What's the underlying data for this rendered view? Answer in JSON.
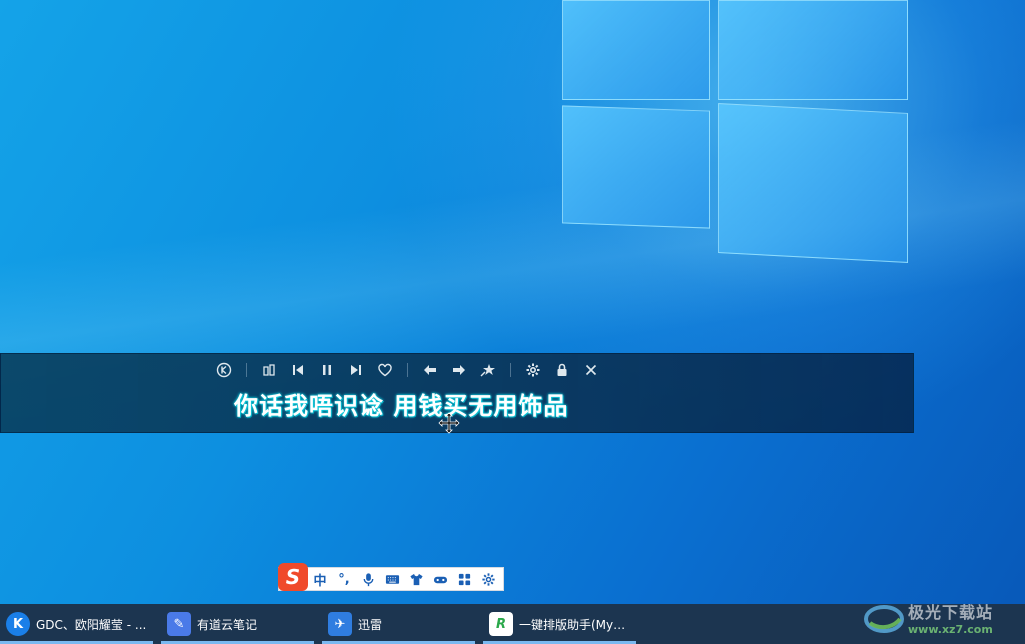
{
  "lyrics": {
    "current_line": "你话我唔识谂  用钱买无用饰品"
  },
  "ime": {
    "logo": "S",
    "items": [
      {
        "name": "chinese-mode",
        "label": "中"
      },
      {
        "name": "punctuation",
        "label": "°,"
      }
    ]
  },
  "taskbar": {
    "items": [
      {
        "label": "GDC、欧阳耀莹 - ...",
        "icon": "kugou-icon",
        "icon_text": "K",
        "color": "#1a7fe8"
      },
      {
        "label": "有道云笔记",
        "icon": "youdao-note-icon",
        "icon_text": "✎",
        "color": "#4a7ae8"
      },
      {
        "label": "迅雷",
        "icon": "xunlei-icon",
        "icon_text": "✈",
        "color": "#2f7de0"
      },
      {
        "label": "一键排版助手(MyE...",
        "icon": "myeditor-icon",
        "icon_text": "R",
        "color": "#ffffff"
      }
    ]
  },
  "watermark": {
    "title": "极光下载站",
    "url": "www.xz7.com"
  },
  "colors": {
    "desktop": "#0d8fe0",
    "lyric_bar": "#0a3c5a",
    "lyric_glow": "#0fd0e0",
    "taskbar": "#1c3550",
    "ime_accent": "#f04a2a"
  }
}
